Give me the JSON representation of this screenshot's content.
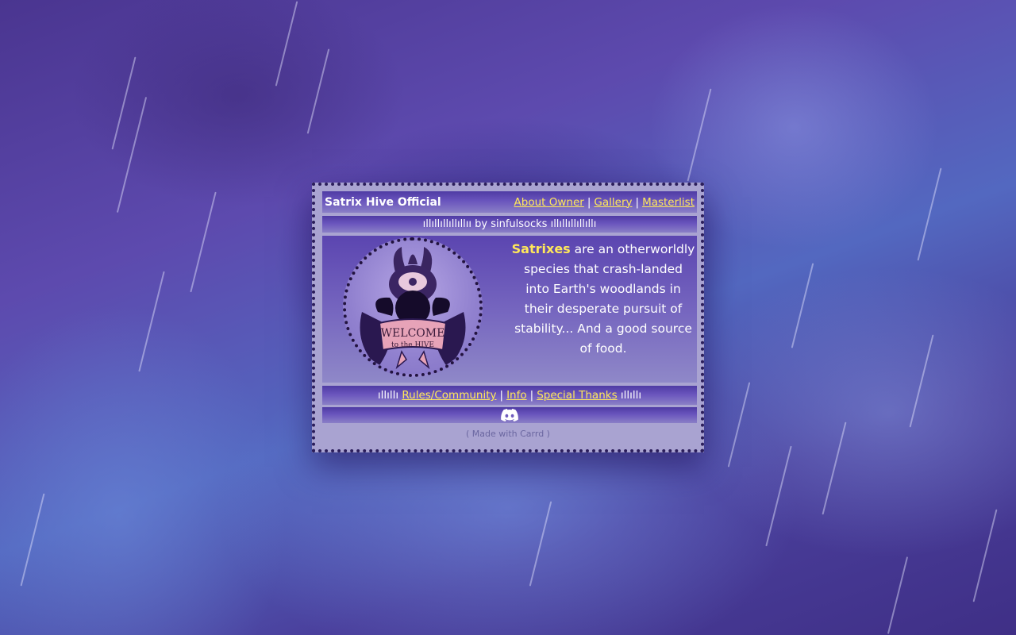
{
  "site": {
    "title": "Satrix Hive Official",
    "nav": [
      {
        "label": "About Owner"
      },
      {
        "label": "Gallery"
      },
      {
        "label": "Masterlist"
      }
    ],
    "separator": "|",
    "byline": "ıllıllıllıllıllıı by sinfulsocks ıllıllıllıllıllı"
  },
  "intro": {
    "highlight": "Satrixes",
    "text": " are an otherworldly species that crash-landed into Earth's woodlands in their desperate pursuit of stability... And a good source of food."
  },
  "badge": {
    "line1": "WELCOME",
    "line2": "to the HIVE"
  },
  "links": {
    "deco_left": "ıllıllı",
    "deco_right": "ıllıllı",
    "items": [
      {
        "label": "Rules/Community"
      },
      {
        "label": "Info"
      },
      {
        "label": "Special Thanks"
      }
    ]
  },
  "social": {
    "icon": "discord-icon"
  },
  "footer": {
    "label": "( Made with Carrd )"
  },
  "colors": {
    "accent": "#ffe85a",
    "band": "#5b45b0",
    "card": "#a9a3d1",
    "border": "#2a1d5a"
  }
}
